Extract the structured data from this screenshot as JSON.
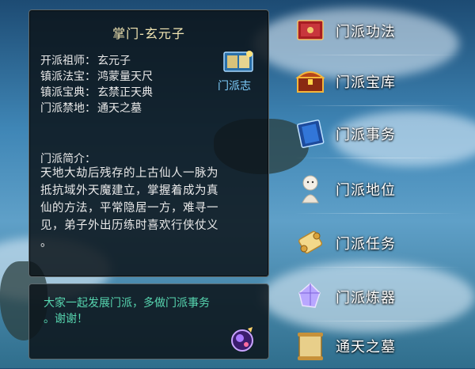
{
  "info": {
    "title": "掌门-玄元子",
    "fields": [
      {
        "key": "开派祖师：",
        "value": "玄元子"
      },
      {
        "key": "镇派法宝：",
        "value": "鸿蒙量天尺"
      },
      {
        "key": "镇派宝典：",
        "value": "玄禁正天典"
      },
      {
        "key": "门派禁地：",
        "value": "通天之墓"
      }
    ],
    "book_label": "门派志",
    "intro_heading": "门派简介：",
    "intro_lines": [
      "天地大劫后残存的上古仙人一脉为",
      "抵抗域外天魔建立，掌握着成为真",
      "仙的方法，平常隐居一方，难寻一",
      "见，弟子外出历练时喜欢行侠仗义",
      "。"
    ]
  },
  "notice": {
    "lines": [
      "大家一起发展门派，多做门派事务",
      "。谢谢！"
    ]
  },
  "menu": [
    {
      "label": "门派功法",
      "icon": "red-book-icon"
    },
    {
      "label": "门派宝库",
      "icon": "treasure-chest-icon"
    },
    {
      "label": "门派事务",
      "icon": "blue-book-icon"
    },
    {
      "label": "门派地位",
      "icon": "doll-icon"
    },
    {
      "label": "门派任务",
      "icon": "scroll-icon"
    },
    {
      "label": "门派炼器",
      "icon": "crystal-icon"
    },
    {
      "label": "通天之墓",
      "icon": "map-scroll-icon"
    }
  ]
}
